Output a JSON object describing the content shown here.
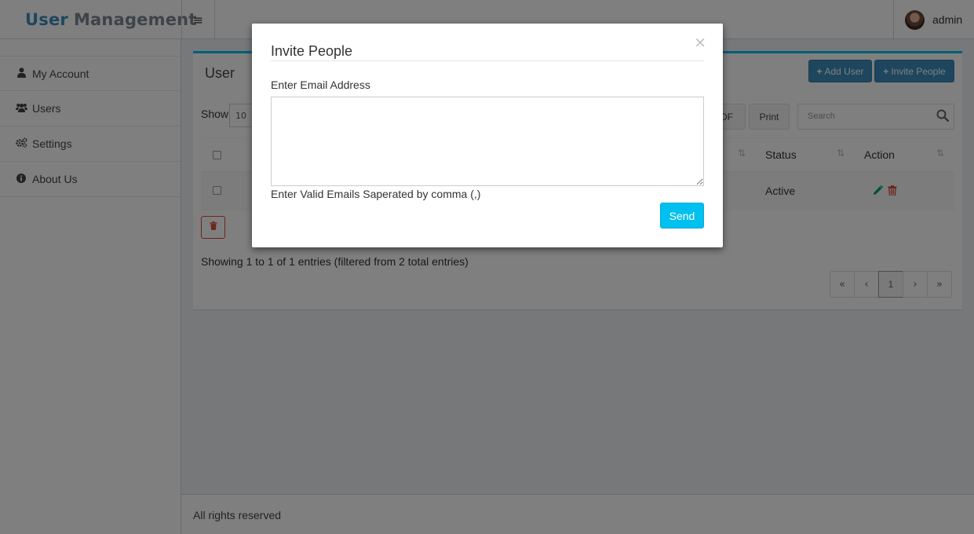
{
  "app": {
    "logo_part1": "User",
    "logo_part2": "Management",
    "username": "admin"
  },
  "sidebar": {
    "items": [
      {
        "label": "My Account",
        "icon": "user-icon"
      },
      {
        "label": "Users",
        "icon": "users-icon"
      },
      {
        "label": "Settings",
        "icon": "gears-icon"
      },
      {
        "label": "About Us",
        "icon": "info-circle-icon"
      }
    ]
  },
  "content": {
    "box_title": "User",
    "add_user_label": "Add User",
    "invite_people_label": "Invite People",
    "show_label": "Show",
    "show_value": "10",
    "pdf_label": "PDF",
    "print_label": "Print",
    "search_placeholder": "Search",
    "table": {
      "columns": [
        "Status",
        "Action"
      ],
      "rows": [
        {
          "status": "Active"
        }
      ]
    },
    "info_text": "Showing 1 to 1 of 1 entries (filtered from 2 total entries)",
    "pagination": {
      "first": "«",
      "prev": "‹",
      "current": "1",
      "next": "›",
      "last": "»"
    }
  },
  "footer": {
    "text": "All rights reserved"
  },
  "modal": {
    "title": "Invite People",
    "close": "×",
    "field_label": "Enter Email Address",
    "email_value": "",
    "help_text": "Enter Valid Emails Saperated by comma (,)",
    "send_label": "Send"
  },
  "colors": {
    "accent": "#00c0ef",
    "primary": "#3c8dbc",
    "danger": "#dd4b39",
    "success": "#00a65a"
  }
}
